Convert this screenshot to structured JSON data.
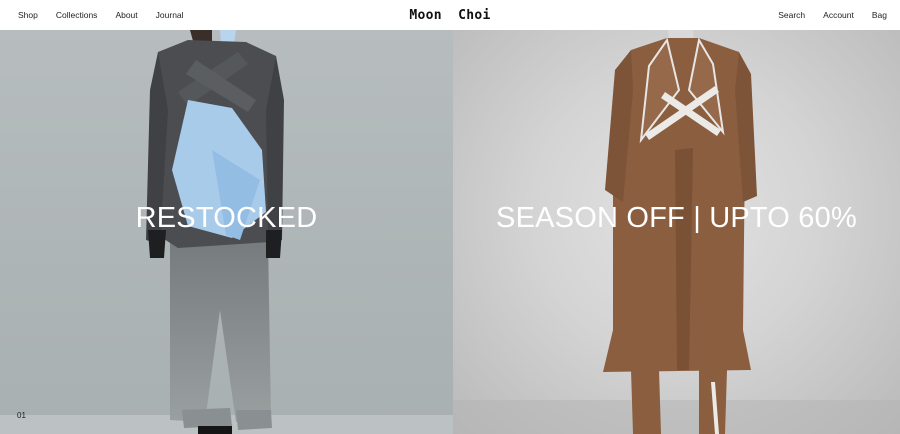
{
  "header": {
    "nav_left": [
      "Shop",
      "Collections",
      "About",
      "Journal"
    ],
    "brand": "Moon  Choi",
    "nav_right": [
      "Search",
      "Account",
      "Bag"
    ]
  },
  "panels": [
    {
      "headline": "RESTOCKED",
      "slide_index": "01"
    },
    {
      "headline": "SEASON OFF | UPTO 60%"
    }
  ]
}
